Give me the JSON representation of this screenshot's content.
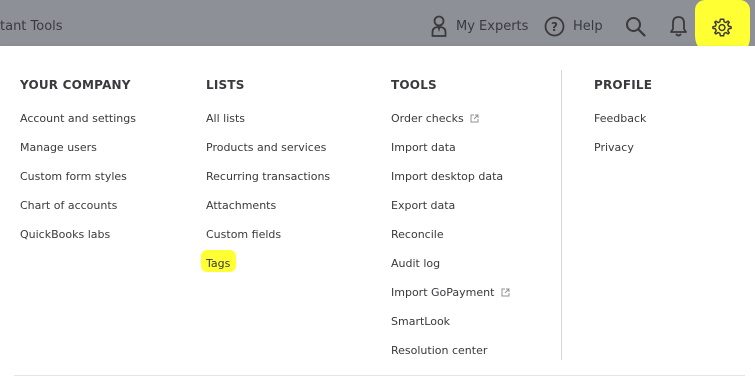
{
  "topbar": {
    "title": "tant Tools",
    "my_experts_label": "My Experts",
    "help_label": "Help",
    "icons": {
      "experts": "person-icon",
      "help": "help-icon",
      "search": "search-icon",
      "notifications": "bell-icon",
      "settings": "gear-icon"
    }
  },
  "columns": {
    "company": {
      "header": "YOUR COMPANY",
      "items": [
        "Account and settings",
        "Manage users",
        "Custom form styles",
        "Chart of accounts",
        "QuickBooks labs"
      ]
    },
    "lists": {
      "header": "LISTS",
      "items": [
        "All lists",
        "Products and services",
        "Recurring transactions",
        "Attachments",
        "Custom fields",
        "Tags"
      ]
    },
    "tools": {
      "header": "TOOLS",
      "items": [
        "Order checks",
        "Import data",
        "Import desktop data",
        "Export data",
        "Reconcile",
        "Audit log",
        "Import GoPayment",
        "SmartLook",
        "Resolution center"
      ]
    },
    "profile": {
      "header": "PROFILE",
      "items": [
        "Feedback",
        "Privacy"
      ]
    }
  },
  "colors": {
    "topbar_bg": "#8d9096",
    "text": "#393a3d",
    "highlight": "#ffff33"
  }
}
